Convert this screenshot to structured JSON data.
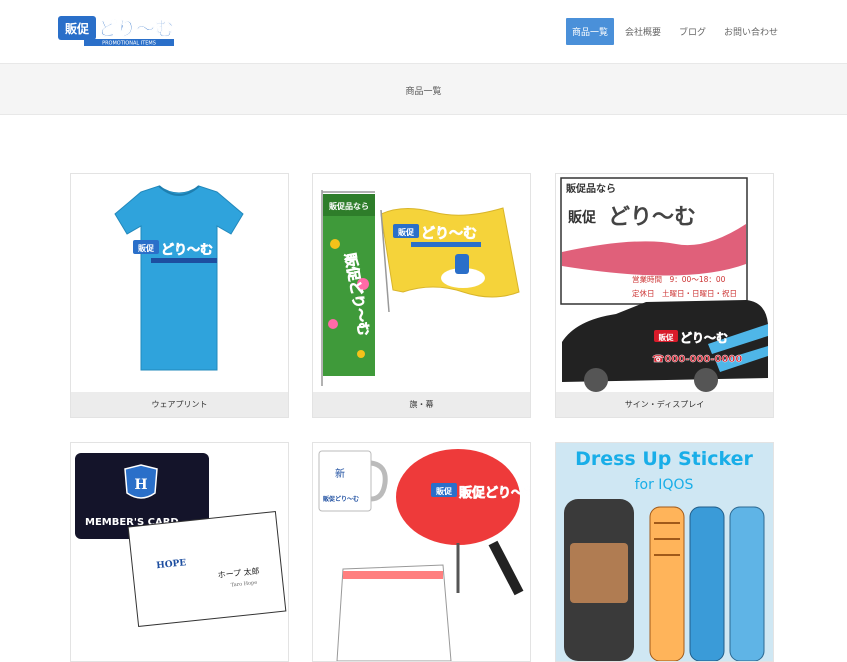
{
  "header": {
    "logo_text": "販促どり〜む",
    "logo_sub": "PROMOTIONAL ITEMS",
    "nav": [
      {
        "label": "商品一覧",
        "active": true
      },
      {
        "label": "会社概要",
        "active": false
      },
      {
        "label": "ブログ",
        "active": false
      },
      {
        "label": "お問い合わせ",
        "active": false
      }
    ]
  },
  "page": {
    "title": "商品一覧"
  },
  "products": [
    {
      "caption": "ウェアプリント",
      "image_text": {
        "brand": "販促どり〜む"
      }
    },
    {
      "caption": "旗・幕",
      "image_text": {
        "banner": "販促品なら",
        "brand": "販促どり〜む"
      }
    },
    {
      "caption": "サイン・ディスプレイ",
      "image_text": {
        "line1": "販促品なら",
        "brand": "販促どり〜む",
        "hours": "営業時間　9：00〜18：00",
        "holiday": "定休日　土曜日・日曜日・祝日",
        "phone": "☎000-000-0000"
      }
    },
    {
      "caption": "",
      "image_text": {
        "card": "MEMBER'S CARD",
        "hope": "HOPE",
        "name": "ホープ 太郎",
        "name_en": "Taro Hope"
      }
    },
    {
      "caption": "",
      "image_text": {
        "brand": "販促どり〜む"
      }
    },
    {
      "caption": "",
      "image_text": {
        "line1": "Dress Up Sticker",
        "line2": "for IQOS"
      }
    }
  ],
  "colors": {
    "accent": "#4a90d9",
    "brand_blue": "#2a6fc9",
    "title_band": "#f5f5f5",
    "caption_bg": "#ececec"
  }
}
